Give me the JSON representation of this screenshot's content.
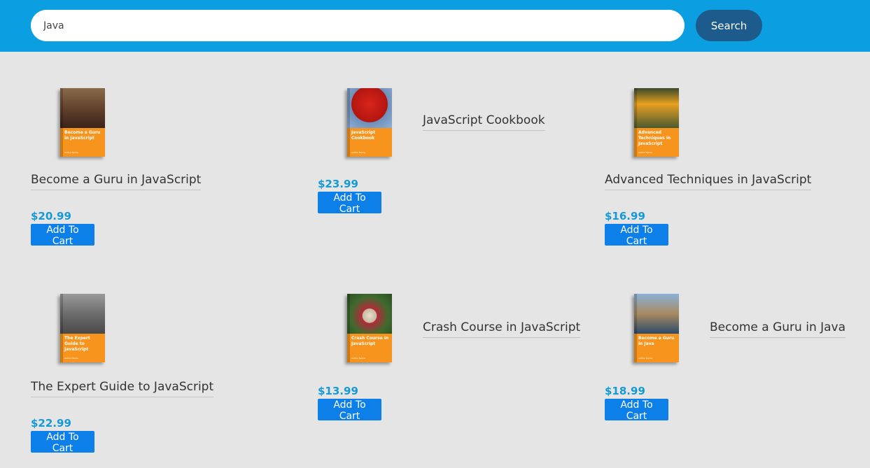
{
  "search": {
    "value": "Java",
    "button_label": "Search"
  },
  "colors": {
    "header": "#0b9ee0",
    "search_button": "#1d5b8c",
    "price": "#159ad6",
    "add_button": "#0d7fe8",
    "cover_orange": "#f7941d",
    "background": "#e5e5e5"
  },
  "products": [
    {
      "title": "Become a Guru in JavaScript",
      "price": "$20.99",
      "button": "Add To Cart",
      "cover_text": "Become a Guru in JavaScript"
    },
    {
      "title": "JavaScript Cookbook",
      "price": "$23.99",
      "button": "Add To Cart",
      "cover_text": "JavaScript Cookbook"
    },
    {
      "title": "Advanced Techniques in JavaScript",
      "price": "$16.99",
      "button": "Add To Cart",
      "cover_text": "Advanced Techniques in JavaScript"
    },
    {
      "title": "The Expert Guide to JavaScript",
      "price": "$22.99",
      "button": "Add To Cart",
      "cover_text": "The Expert Guide to JavaScript"
    },
    {
      "title": "Crash Course in JavaScript",
      "price": "$13.99",
      "button": "Add To Cart",
      "cover_text": "Crash Course in JavaScript"
    },
    {
      "title": "Become a Guru in Java",
      "price": "$18.99",
      "button": "Add To Cart",
      "cover_text": "Become a Guru in Java"
    }
  ]
}
